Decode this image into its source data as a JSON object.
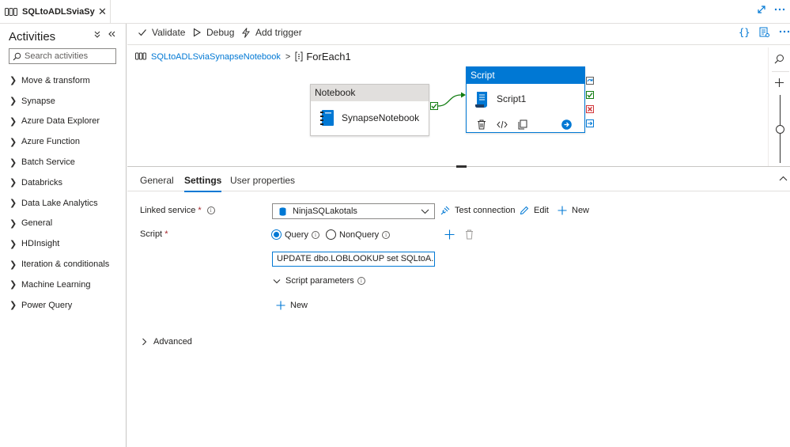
{
  "tab": {
    "title": "SQLtoADLSviaSyna...",
    "close": "✕"
  },
  "activities": {
    "title": "Activities",
    "search_placeholder": "Search activities",
    "items": [
      {
        "label": "Move & transform"
      },
      {
        "label": "Synapse"
      },
      {
        "label": "Azure Data Explorer"
      },
      {
        "label": "Azure Function"
      },
      {
        "label": "Batch Service"
      },
      {
        "label": "Databricks"
      },
      {
        "label": "Data Lake Analytics"
      },
      {
        "label": "General"
      },
      {
        "label": "HDInsight"
      },
      {
        "label": "Iteration & conditionals"
      },
      {
        "label": "Machine Learning"
      },
      {
        "label": "Power Query"
      }
    ]
  },
  "toolbar": {
    "validate": "Validate",
    "debug": "Debug",
    "add_trigger": "Add trigger"
  },
  "breadcrumb": {
    "pipeline": "SQLtoADLSviaSynapseNotebook",
    "separator": ">",
    "current": "ForEach1"
  },
  "canvas": {
    "notebook": {
      "type": "Notebook",
      "name": "SynapseNotebook"
    },
    "script": {
      "type": "Script",
      "name": "Script1"
    }
  },
  "settings": {
    "tabs": [
      {
        "label": "General"
      },
      {
        "label": "Settings"
      },
      {
        "label": "User properties"
      }
    ],
    "active_tab": "Settings",
    "linked_service": {
      "label": "Linked service",
      "required": "*",
      "value": "NinjaSQLakotals",
      "test_connection": "Test connection",
      "edit": "Edit",
      "new": "New"
    },
    "script": {
      "label": "Script",
      "required": "*",
      "query_option": "Query",
      "nonquery_option": "NonQuery",
      "selected": "Query",
      "query_text": "UPDATE dbo.LOBLOOKUP set SQLtoA...",
      "params_label": "Script parameters",
      "new_param": "New"
    },
    "advanced": "Advanced"
  },
  "colors": {
    "accent": "#0078d4",
    "success": "#107c10",
    "error": "#d13438"
  }
}
